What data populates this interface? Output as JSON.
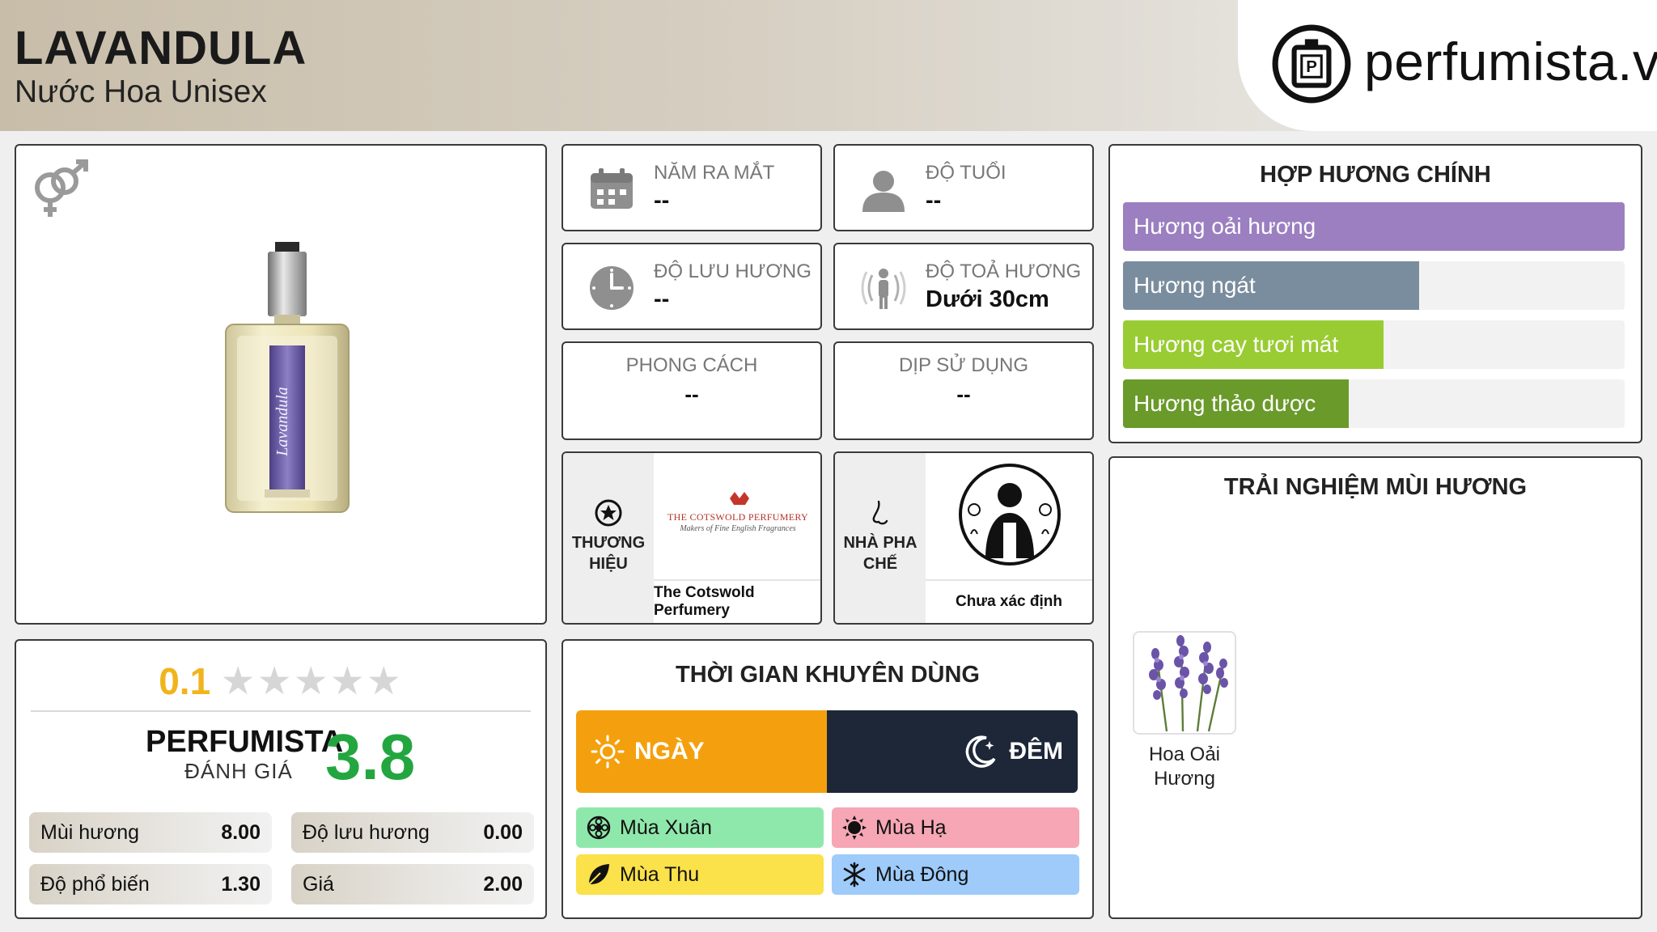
{
  "header": {
    "title": "LAVANDULA",
    "subtitle": "Nước Hoa Unisex",
    "logo_text": "perfumista.vn",
    "logo_icon": "perfume-bottle-logo-icon"
  },
  "product": {
    "gender_icon": "unisex-icon",
    "image": "lavandula-bottle"
  },
  "rating": {
    "user_score": "0.1",
    "stars_max": 5,
    "brand_label": "PERFUMISTA",
    "brand_sub": "ĐÁNH GIÁ",
    "score": "3.8",
    "metrics": [
      {
        "label": "Mùi hương",
        "value": "8.00"
      },
      {
        "label": "Độ lưu hương",
        "value": "0.00"
      },
      {
        "label": "Độ phổ biến",
        "value": "1.30"
      },
      {
        "label": "Giá",
        "value": "2.00"
      }
    ]
  },
  "info": {
    "year": {
      "label": "NĂM RA MẮT",
      "value": "--",
      "icon": "calendar-icon"
    },
    "age": {
      "label": "ĐỘ TUỔI",
      "value": "--",
      "icon": "person-icon"
    },
    "longevity": {
      "label": "ĐỘ LƯU HƯƠNG",
      "value": "--",
      "icon": "clock-icon"
    },
    "sillage": {
      "label": "ĐỘ TOẢ HƯƠNG",
      "value": "Dưới 30cm",
      "icon": "sillage-icon"
    },
    "style": {
      "label": "PHONG CÁCH",
      "value": "--"
    },
    "occasion": {
      "label": "DỊP SỬ DỤNG",
      "value": "--"
    }
  },
  "brand": {
    "label": "THƯƠNG HIỆU",
    "logo_line1": "THE COTSWOLD PERFUMERY",
    "logo_line2": "Makers of Fine English Fragrances",
    "name": "The Cotswold Perfumery"
  },
  "perfumer": {
    "label": "NHÀ PHA CHẾ",
    "name": "Chưa xác định"
  },
  "time": {
    "title": "THỜI GIAN KHUYÊN DÙNG",
    "day": "NGÀY",
    "night": "ĐÊM",
    "seasons": [
      {
        "label": "Mùa Xuân",
        "color": "#8fe8ab",
        "icon": "spring-flower-icon"
      },
      {
        "label": "Mùa Hạ",
        "color": "#f6a6b4",
        "icon": "summer-sun-icon"
      },
      {
        "label": "Mùa Thu",
        "color": "#fbe14a",
        "icon": "autumn-leaf-icon"
      },
      {
        "label": "Mùa Đông",
        "color": "#9ecbfa",
        "icon": "winter-snowflake-icon"
      }
    ]
  },
  "accords": {
    "title": "HỢP HƯƠNG CHÍNH",
    "items": [
      {
        "label": "Hương oải hương",
        "value": 1.0,
        "color": "#9b7fc0"
      },
      {
        "label": "Hương ngát",
        "value": 0.59,
        "color": "#7a8d9e"
      },
      {
        "label": "Hương cay tươi mát",
        "value": 0.52,
        "color": "#99cc33"
      },
      {
        "label": "Hương thảo dược",
        "value": 0.45,
        "color": "#6a9a2a"
      }
    ]
  },
  "experience": {
    "title": "TRẢI NGHIỆM MÙI HƯƠNG",
    "notes": [
      {
        "name": "Hoa Oải Hương"
      }
    ]
  }
}
